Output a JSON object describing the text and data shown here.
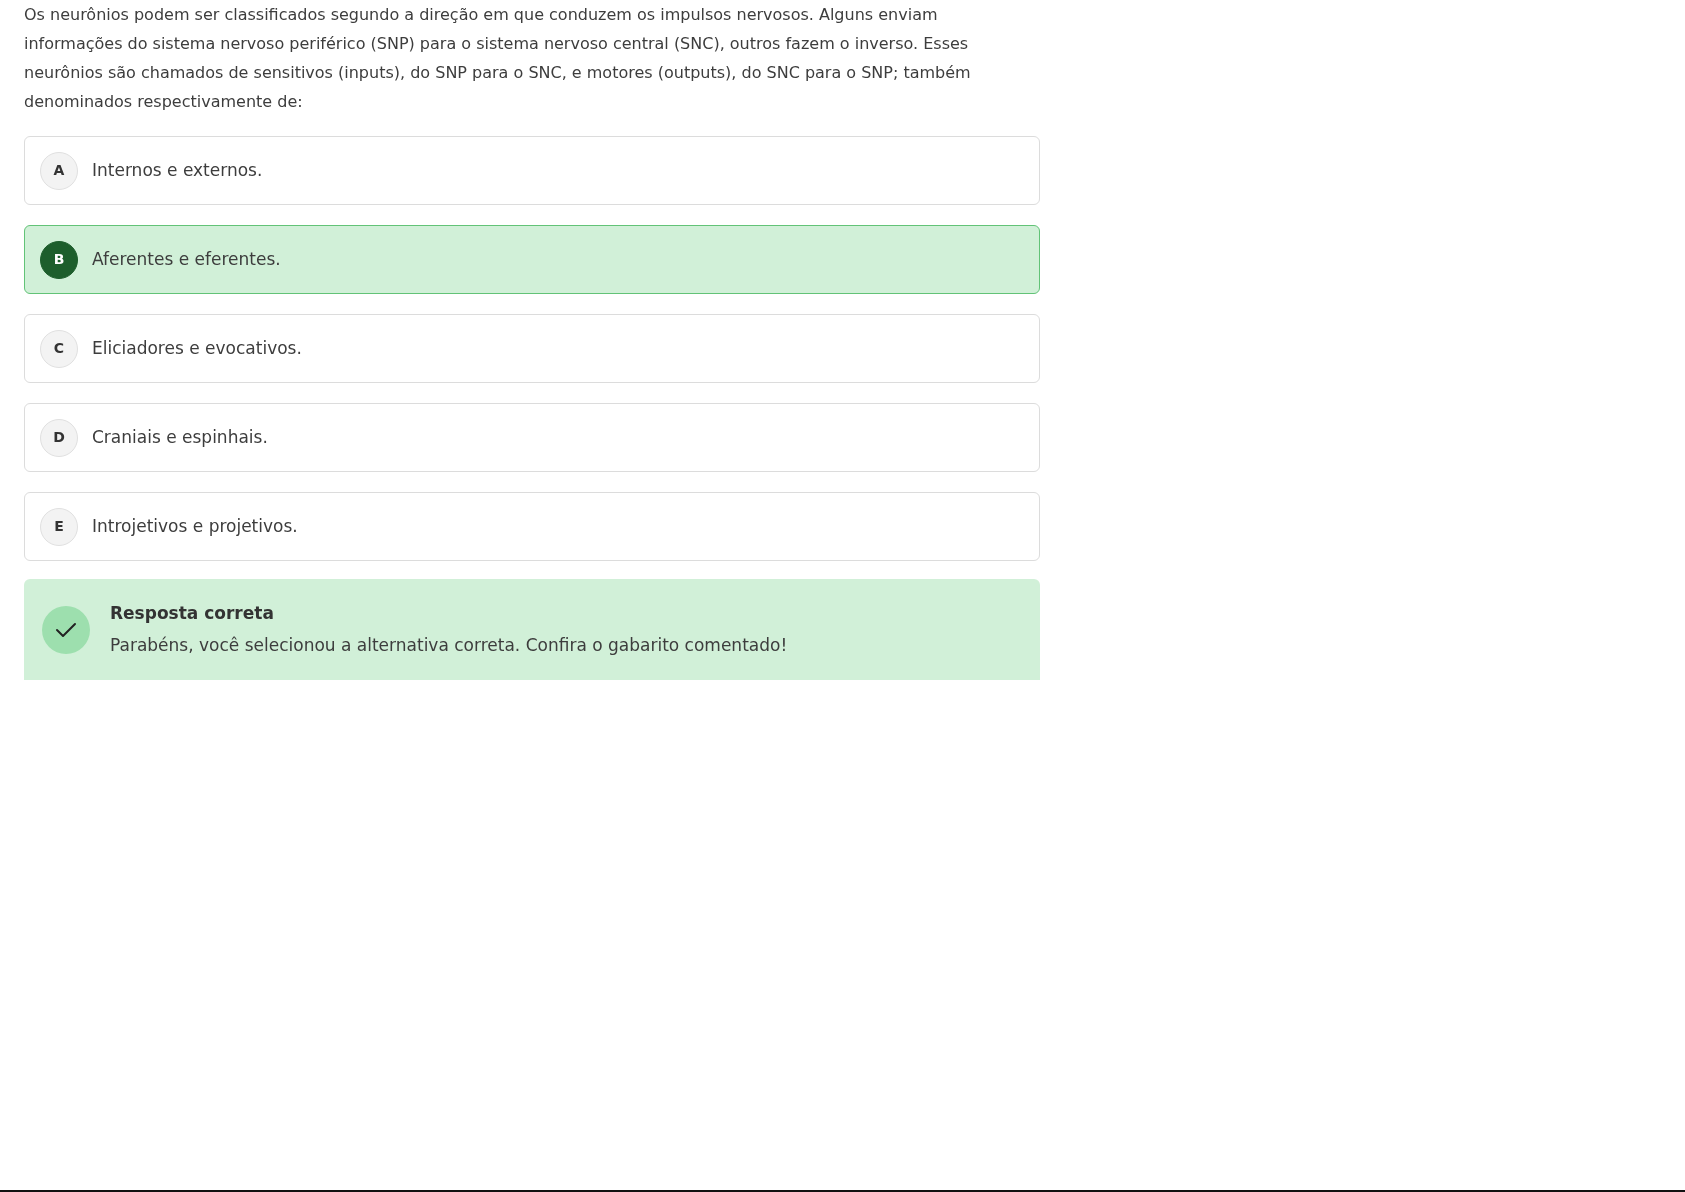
{
  "question": "Os neurônios podem ser classificados segundo a direção em que conduzem os impulsos nervosos. Alguns enviam informações do sistema nervoso periférico (SNP) para o sistema nervoso central (SNC), outros fazem o inverso. Esses neurônios são chamados de sensitivos (inputs), do SNP para o SNC, e motores (outputs), do SNC para o SNP; também denominados respectivamente de:",
  "options": [
    {
      "letter": "A",
      "text": "Internos e externos.",
      "selected": false
    },
    {
      "letter": "B",
      "text": "Aferentes e eferentes.",
      "selected": true
    },
    {
      "letter": "C",
      "text": "Eliciadores e evocativos.",
      "selected": false
    },
    {
      "letter": "D",
      "text": "Craniais e espinhais.",
      "selected": false
    },
    {
      "letter": "E",
      "text": "Introjetivos e projetivos.",
      "selected": false
    }
  ],
  "feedback": {
    "kind": "correct",
    "title": "Resposta correta",
    "message": "Parabéns, você selecionou a alternativa correta. Confira o gabarito comentado!"
  }
}
